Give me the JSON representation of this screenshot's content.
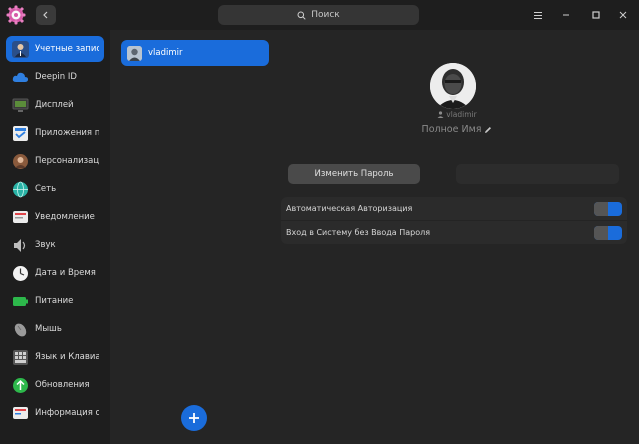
{
  "titlebar": {
    "search_placeholder": "Поиск"
  },
  "sidebar": {
    "items": [
      {
        "label": "Учетные записи",
        "icon": "user-accounts-icon",
        "active": true
      },
      {
        "label": "Deepin ID",
        "icon": "cloud-icon"
      },
      {
        "label": "Дисплей",
        "icon": "display-icon"
      },
      {
        "label": "Приложения п...",
        "icon": "default-apps-icon"
      },
      {
        "label": "Персонализац...",
        "icon": "personalization-icon"
      },
      {
        "label": "Сеть",
        "icon": "network-icon"
      },
      {
        "label": "Уведомление",
        "icon": "notification-icon"
      },
      {
        "label": "Звук",
        "icon": "sound-icon"
      },
      {
        "label": "Дата и Время",
        "icon": "clock-icon"
      },
      {
        "label": "Питание",
        "icon": "battery-icon"
      },
      {
        "label": "Мышь",
        "icon": "mouse-icon"
      },
      {
        "label": "Язык и Клавиа...",
        "icon": "keyboard-icon"
      },
      {
        "label": "Обновления",
        "icon": "update-icon"
      },
      {
        "label": "Информация о...",
        "icon": "system-info-icon"
      }
    ]
  },
  "users": {
    "list": [
      {
        "name": "vladimir"
      }
    ]
  },
  "detail": {
    "username": "vladimir",
    "full_name": "Полное Имя",
    "change_password_label": "Изменить Пароль",
    "settings": [
      {
        "label": "Автоматическая Авторизация",
        "enabled": true
      },
      {
        "label": "Вход в Систему без Ввода Пароля",
        "enabled": true
      }
    ]
  },
  "colors": {
    "accent": "#1a6cdb",
    "background": "#252525",
    "sidebar": "#1e1e1e"
  }
}
